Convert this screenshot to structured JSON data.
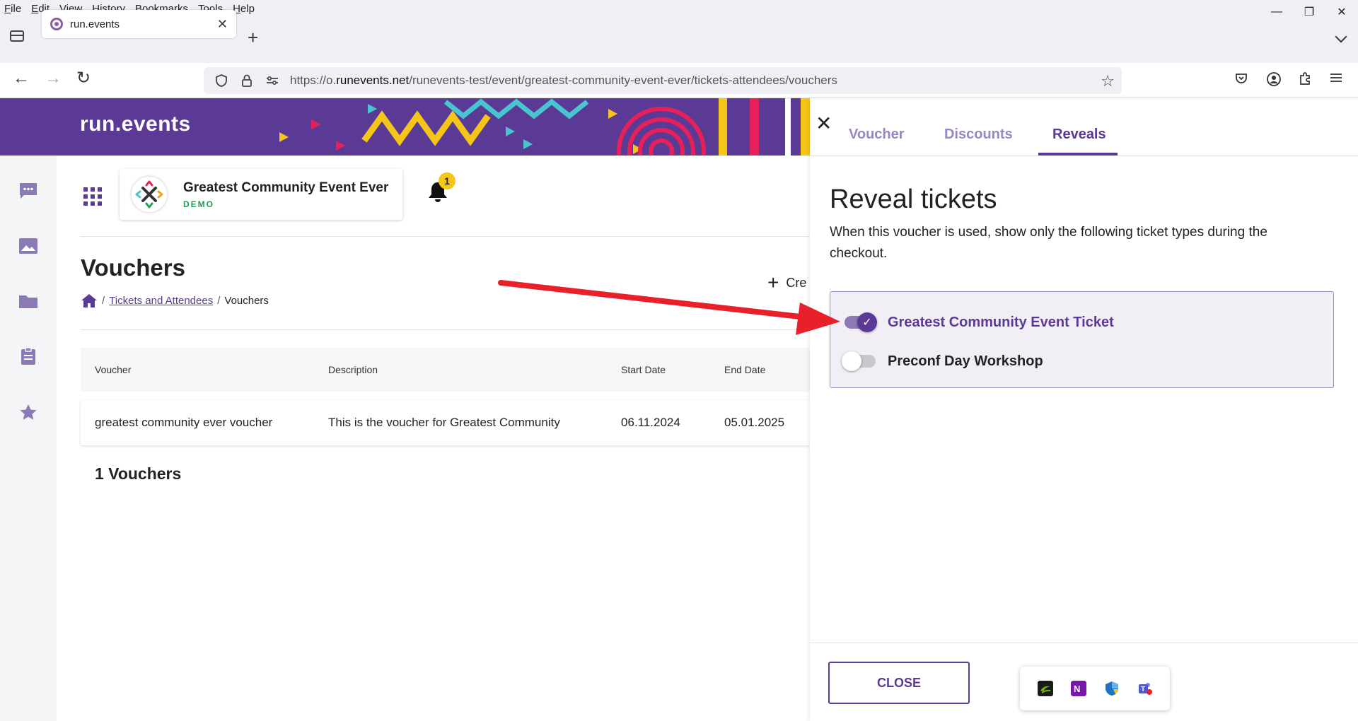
{
  "menubar": {
    "items": [
      {
        "key": "F",
        "rest": "ile"
      },
      {
        "key": "E",
        "rest": "dit"
      },
      {
        "key": "V",
        "rest": "iew"
      },
      {
        "key": "H",
        "rest": "istory"
      },
      {
        "key": "B",
        "rest": "ookmarks"
      },
      {
        "key": "T",
        "rest": "ools"
      },
      {
        "key": "H",
        "rest": "elp"
      }
    ]
  },
  "window_controls": {
    "minimize": "—",
    "restore": "❐",
    "close": "✕"
  },
  "browser_tab": {
    "title": "run.events",
    "close": "✕",
    "new_tab": "+"
  },
  "urlbar": {
    "url_prefix": "https://o.",
    "url_domain": "runevents.net",
    "url_path": "/runevents-test/event/greatest-community-event-ever/tickets-attendees/vouchers"
  },
  "nav": {
    "back": "←",
    "forward": "→",
    "reload": "↻"
  },
  "brand": {
    "name": "run.events"
  },
  "event": {
    "title": "Greatest Community Event Ever",
    "tag": "DEMO"
  },
  "notifications": {
    "count": "1"
  },
  "page": {
    "title": "Vouchers",
    "breadcrumb": [
      {
        "label": "Tickets and Attendees"
      },
      {
        "label": "Vouchers"
      }
    ],
    "create_label": "Cre"
  },
  "table": {
    "columns": [
      "Voucher",
      "Description",
      "Start Date",
      "End Date"
    ],
    "rows": [
      [
        "greatest community ever voucher",
        "This is the voucher for Greatest Community",
        "06.11.2024",
        "05.01.2025"
      ]
    ],
    "count_label": "1 Vouchers"
  },
  "drawer": {
    "close_icon": "✕",
    "tabs": [
      {
        "label": "Voucher",
        "active": false
      },
      {
        "label": "Discounts",
        "active": false
      },
      {
        "label": "Reveals",
        "active": true
      }
    ],
    "title": "Reveal tickets",
    "description": "When this voucher is used, show only the following ticket types during the checkout.",
    "tickets": [
      {
        "label": "Greatest Community Event Ticket",
        "enabled": true
      },
      {
        "label": "Preconf Day Workshop",
        "enabled": false
      }
    ],
    "close_button": "CLOSE"
  },
  "colors": {
    "brand_purple": "#5b3a96",
    "tab_inactive": "#9a86c4",
    "demo_green": "#1ea055",
    "badge_yellow": "#f5c518",
    "arrow_red": "#e8202a"
  }
}
